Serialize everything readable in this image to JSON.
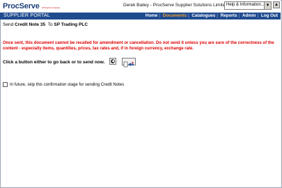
{
  "header": {
    "logo_text": "ProcServe",
    "logo_tagline": "A Proactis company",
    "user_info": "Derek Bailey - ProcServe Supplier Solutions Limited",
    "help_select": "Help & Information..."
  },
  "navbar": {
    "portal_label": "SUPPLIER PORTAL",
    "items": [
      {
        "label": "Home"
      },
      {
        "label": "Documents",
        "active": true
      },
      {
        "label": "Catalogues"
      },
      {
        "label": "Reports"
      },
      {
        "label": "Admin"
      },
      {
        "label": "Log Out"
      }
    ],
    "active_color": "#f0a030",
    "bar_color": "#1f4b8f"
  },
  "main": {
    "send_prefix": "Send",
    "document": "Credit Note 35",
    "to_label": "To",
    "recipient": "SP Trading PLC",
    "warning": "Once sent, this document cannot be recalled for amendment or cancellation. Do not send it unless you are sure of the correctness of the content - especially items, quantities, prices, tax rates and, if in foreign currency, exchange rate.",
    "warning_color": "#e00000",
    "instruction": "Click a button either to go back or to send now.",
    "skip_label": "In future, skip this confirmation stage for sending Credit Notes",
    "skip_checked": false
  }
}
